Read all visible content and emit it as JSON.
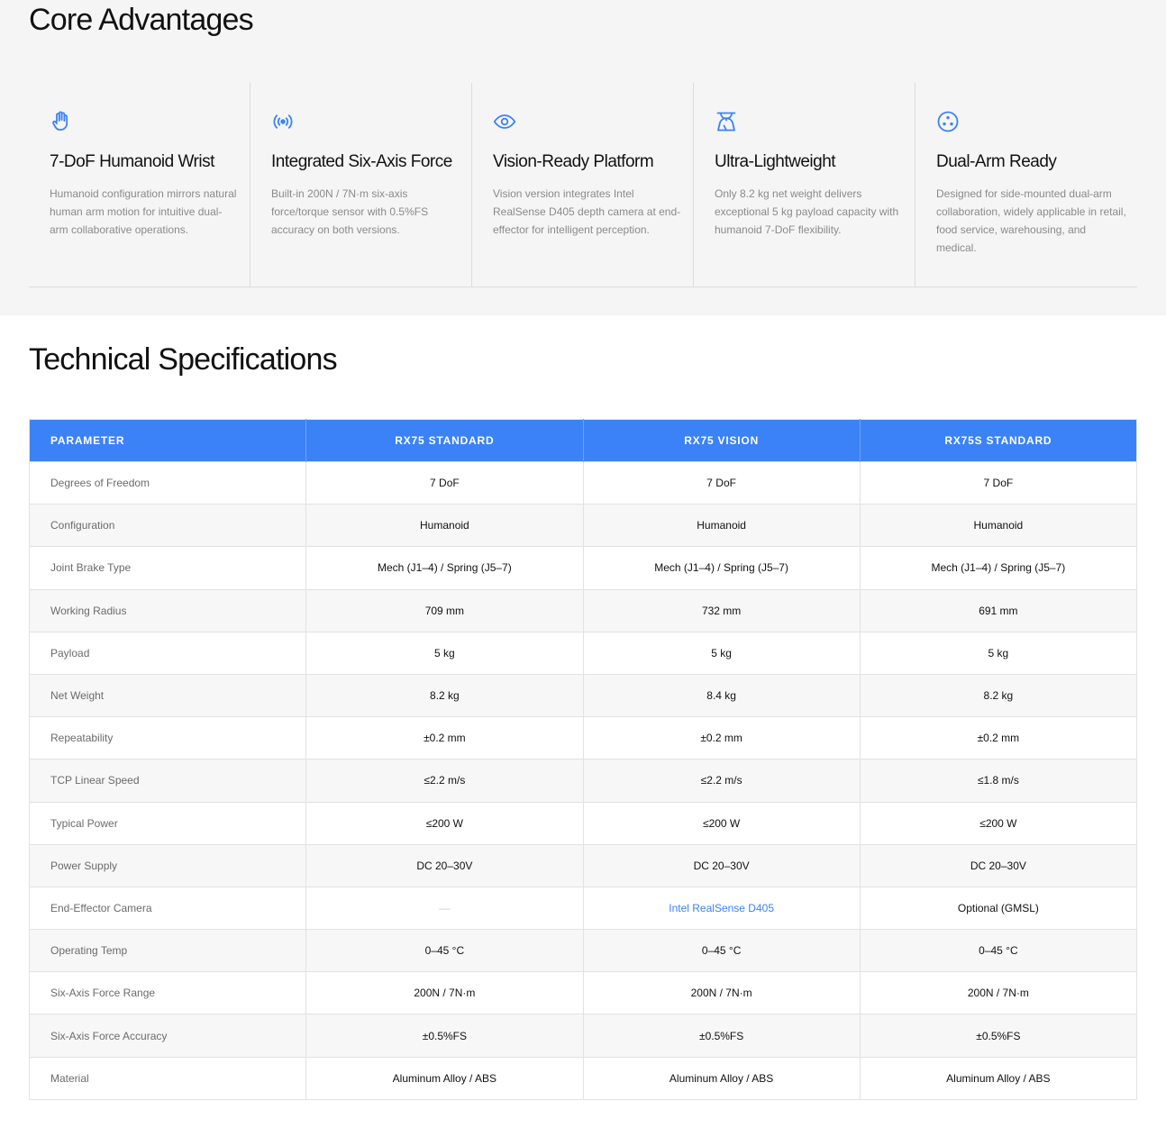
{
  "advantages": {
    "title": "Core Advantages",
    "accent_color": "#3b82f6",
    "items": [
      {
        "icon": "hand-icon",
        "title": "7-DoF Humanoid Wrist",
        "desc": "Humanoid configuration mirrors natural human arm motion for intuitive dual-arm collaborative operations."
      },
      {
        "icon": "broadcast-icon",
        "title": "Integrated Six-Axis Force",
        "desc": "Built-in 200N / 7N·m six-axis force/torque sensor with 0.5%FS accuracy on both versions."
      },
      {
        "icon": "eye-icon",
        "title": "Vision-Ready Platform",
        "desc": "Vision version integrates Intel RealSense D405 depth camera at end-effector for intelligent perception."
      },
      {
        "icon": "scale-icon",
        "title": "Ultra-Lightweight",
        "desc": "Only 8.2 kg net weight delivers exceptional 5 kg payload capacity with humanoid 7-DoF flexibility."
      },
      {
        "icon": "dual-circle-icon",
        "title": "Dual-Arm Ready",
        "desc": "Designed for side-mounted dual-arm collaboration, widely applicable in retail, food service, warehousing, and medical."
      }
    ]
  },
  "specs": {
    "title": "Technical Specifications",
    "header_color": "#3b82f6",
    "columns": [
      "Parameter",
      "RX75 Standard",
      "RX75 Vision",
      "RX75S Standard"
    ],
    "rows": [
      [
        "Degrees of Freedom",
        "7 DoF",
        "7 DoF",
        "7 DoF"
      ],
      [
        "Configuration",
        "Humanoid",
        "Humanoid",
        "Humanoid"
      ],
      [
        "Joint Brake Type",
        "Mech (J1–4) / Spring (J5–7)",
        "Mech (J1–4) / Spring (J5–7)",
        "Mech (J1–4) / Spring (J5–7)"
      ],
      [
        "Working Radius",
        "709 mm",
        "732 mm",
        "691 mm"
      ],
      [
        "Payload",
        "5 kg",
        "5 kg",
        "5 kg"
      ],
      [
        "Net Weight",
        "8.2 kg",
        "8.4 kg",
        "8.2 kg"
      ],
      [
        "Repeatability",
        "±0.2 mm",
        "±0.2 mm",
        "±0.2 mm"
      ],
      [
        "TCP Linear Speed",
        "≤2.2 m/s",
        "≤2.2 m/s",
        "≤1.8 m/s"
      ],
      [
        "Typical Power",
        "≤200 W",
        "≤200 W",
        "≤200 W"
      ],
      [
        "Power Supply",
        "DC 20–30V",
        "DC 20–30V",
        "DC 20–30V"
      ],
      [
        "End-Effector Camera",
        "—",
        "Intel RealSense D405",
        "Optional (GMSL)"
      ],
      [
        "Operating Temp",
        "0–45 °C",
        "0–45 °C",
        "0–45 °C"
      ],
      [
        "Six-Axis Force Range",
        "200N / 7N·m",
        "200N / 7N·m",
        "200N / 7N·m"
      ],
      [
        "Six-Axis Force Accuracy",
        "±0.5%FS",
        "±0.5%FS",
        "±0.5%FS"
      ],
      [
        "Material",
        "Aluminum Alloy / ABS",
        "Aluminum Alloy / ABS",
        "Aluminum Alloy / ABS"
      ]
    ]
  }
}
